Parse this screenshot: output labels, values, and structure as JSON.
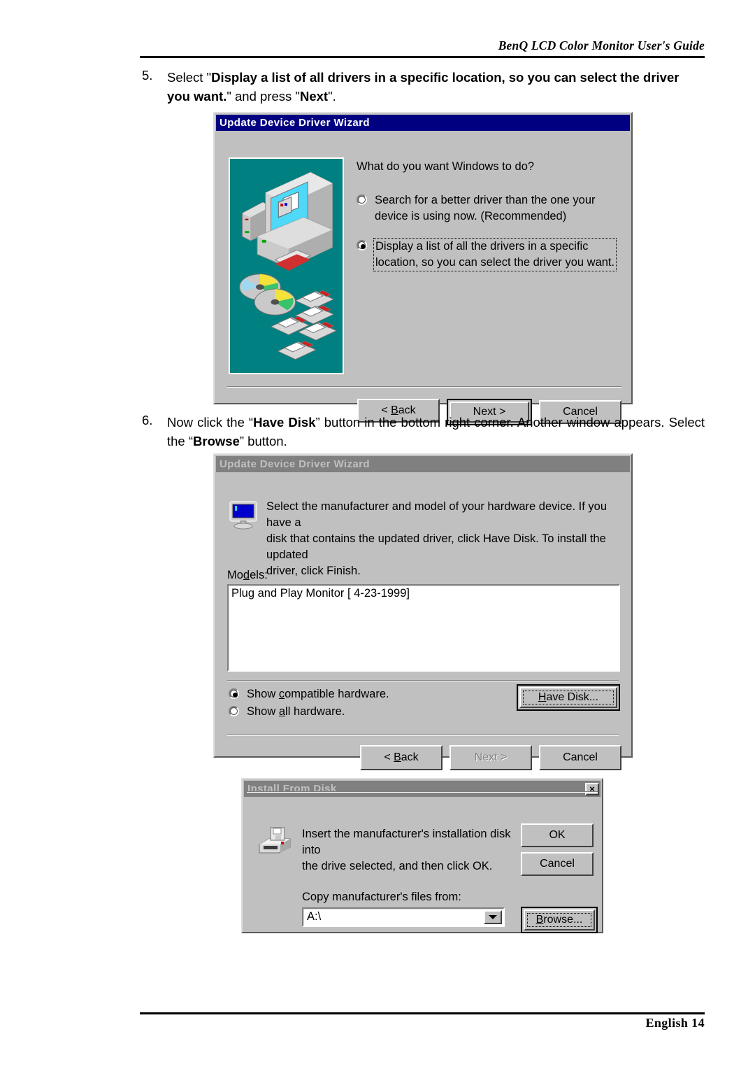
{
  "page": {
    "header": "BenQ LCD Color Monitor User's Guide",
    "footer": "English  14"
  },
  "steps": [
    {
      "number": "5.",
      "segments": [
        {
          "text": "Select \"",
          "bold": false
        },
        {
          "text": "Display a list of all drivers in a specific location, so you can select the driver you want.",
          "bold": true
        },
        {
          "text": "\" and press \"",
          "bold": false
        },
        {
          "text": "Next",
          "bold": true
        },
        {
          "text": "\".",
          "bold": false
        }
      ],
      "plain": "Select \"Display a list of all drivers in a specific location, so you can select the driver you want.\" and press \"Next\"."
    },
    {
      "number": "6.",
      "segments": [
        {
          "text": "Now click the “",
          "bold": false
        },
        {
          "text": "Have Disk",
          "bold": true
        },
        {
          "text": "” button in the bottom right corner. Another window appears. Select the “",
          "bold": false
        },
        {
          "text": "Browse",
          "bold": true
        },
        {
          "text": "” button.",
          "bold": false
        }
      ],
      "plain": "Now click the “Have Disk” button in the bottom right corner. Another window appears. Select the “Browse” button."
    }
  ],
  "dialog1": {
    "title": "Update Device Driver Wizard",
    "title_state": "active",
    "question": "What do you want Windows to do?",
    "options": [
      {
        "line1": "Search for a better driver than the one your",
        "line2": "device is using now. (Recommended)",
        "selected": false,
        "focused": false
      },
      {
        "line1": "Display a list of all the drivers in a specific",
        "line2": "location, so you can select the driver you want.",
        "selected": true,
        "focused": true
      }
    ],
    "buttons": [
      {
        "label": "< Back",
        "accel": "B",
        "default": false,
        "disabled": false
      },
      {
        "label": "Next >",
        "accel": "",
        "default": true,
        "disabled": false
      },
      {
        "label": "Cancel",
        "accel": "",
        "default": false,
        "disabled": false
      }
    ],
    "illustration": "computer-monitor-cds-floppies-illustration",
    "illustration_bg": "#008080"
  },
  "dialog2": {
    "title": "Update Device Driver Wizard",
    "title_state": "inactive",
    "icon": "monitor-icon",
    "intro_lines": [
      "Select the manufacturer and model of your hardware device. If you have a",
      "disk that contains the updated driver, click Have Disk. To install the updated",
      "driver, click Finish."
    ],
    "models_label": "Models:",
    "models_accel": "d",
    "models": [
      "Plug and Play Monitor [ 4-23-1999]"
    ],
    "radios": [
      {
        "label": "Show compatible hardware.",
        "accel": "c",
        "selected": true
      },
      {
        "label": "Show all hardware.",
        "accel": "a",
        "selected": false
      }
    ],
    "have_disk": {
      "label": "Have Disk...",
      "accel": "H",
      "default": true,
      "focused": true
    },
    "buttons": [
      {
        "label": "< Back",
        "accel": "B",
        "default": false,
        "disabled": false
      },
      {
        "label": "Next >",
        "accel": "",
        "default": false,
        "disabled": true
      },
      {
        "label": "Cancel",
        "accel": "",
        "default": false,
        "disabled": false
      }
    ]
  },
  "dialog3": {
    "title": "Install From Disk",
    "title_state": "inactive",
    "close_icon": "close-x-icon",
    "close_label": "×",
    "icon": "floppy-drive-icon",
    "message_lines": [
      "Insert the manufacturer's installation disk into",
      "the drive selected, and then click OK."
    ],
    "ok_label": "OK",
    "cancel_label": "Cancel",
    "copy_label": "Copy manufacturer's files from:",
    "drive_value": "A:\\",
    "dropdown_icon": "chevron-down-icon",
    "browse": {
      "label": "Browse...",
      "accel": "B",
      "default": true,
      "focused": true
    }
  },
  "colors": {
    "title_active": "#000080",
    "title_inactive": "#808080",
    "dialog_face": "#c0c0c0",
    "illustration_teal": "#008080",
    "monitor_screen_blue": "#0000cc"
  }
}
